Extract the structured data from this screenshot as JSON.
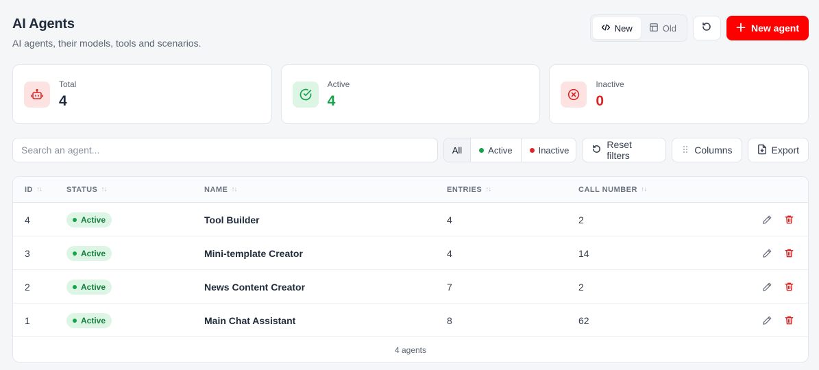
{
  "header": {
    "title": "AI Agents",
    "subtitle": "AI agents, their models, tools and scenarios."
  },
  "view_toggle": {
    "new_label": "New",
    "old_label": "Old",
    "selected": "New"
  },
  "new_agent_label": "New agent",
  "stats": [
    {
      "label": "Total",
      "value": "4",
      "color": "#1f2a3a",
      "icon": "robot-icon",
      "icon_bg": "#fde2e2",
      "icon_color": "#dc2626"
    },
    {
      "label": "Active",
      "value": "4",
      "color": "#16a34a",
      "icon": "check-circle-icon",
      "icon_bg": "#dcf5e4",
      "icon_color": "#16a34a"
    },
    {
      "label": "Inactive",
      "value": "0",
      "color": "#dc2626",
      "icon": "x-circle-icon",
      "icon_bg": "#fde2e2",
      "icon_color": "#dc2626"
    }
  ],
  "search": {
    "placeholder": "Search an agent...",
    "value": ""
  },
  "filters": {
    "all": "All",
    "active": "Active",
    "inactive": "Inactive",
    "selected": "All"
  },
  "toolbar": {
    "reset": "Reset filters",
    "columns": "Columns",
    "export": "Export"
  },
  "table": {
    "columns": [
      "ID",
      "STATUS",
      "NAME",
      "ENTRIES",
      "CALL NUMBER"
    ],
    "rows": [
      {
        "id": "4",
        "status": "Active",
        "name": "Tool Builder",
        "entries": "4",
        "calls": "2"
      },
      {
        "id": "3",
        "status": "Active",
        "name": "Mini-template Creator",
        "entries": "4",
        "calls": "14"
      },
      {
        "id": "2",
        "status": "Active",
        "name": "News Content Creator",
        "entries": "7",
        "calls": "2"
      },
      {
        "id": "1",
        "status": "Active",
        "name": "Main Chat Assistant",
        "entries": "8",
        "calls": "62"
      }
    ],
    "footer": "4 agents"
  },
  "colors": {
    "brand": "#ff0000",
    "active": "#16a34a",
    "inactive": "#dc2626"
  }
}
